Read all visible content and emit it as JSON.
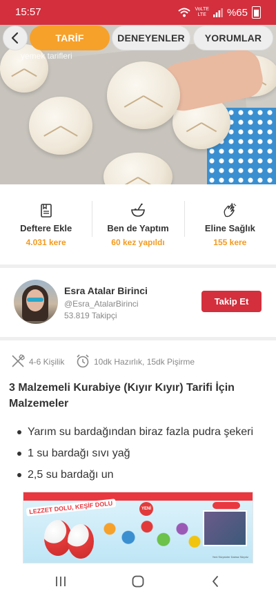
{
  "status_bar": {
    "time": "15:57",
    "network_top": "VoLTE",
    "network_bottom": "LTE",
    "battery": "%65"
  },
  "hero": {
    "watermark": "yemek tarifleri",
    "image_description": "powdered sugar cookies on a baking tray"
  },
  "nav": {
    "back_icon": "chevron-left-icon",
    "tabs": [
      {
        "label": "TARİF",
        "active": true
      },
      {
        "label": "DENEYENLER",
        "active": false
      },
      {
        "label": "YORUMLAR",
        "active": false
      }
    ],
    "active_color": "#f6a12a"
  },
  "actions": [
    {
      "icon": "notebook-icon",
      "label": "Deftere Ekle",
      "count": "4.031 kere"
    },
    {
      "icon": "mixing-bowl-icon",
      "label": "Ben de Yaptım",
      "count": "60 kez yapıldı"
    },
    {
      "icon": "clapping-hands-icon",
      "label": "Eline Sağlık",
      "count": "155 kere"
    }
  ],
  "author": {
    "name": "Esra Atalar Birinci",
    "handle": "@Esra_AtalarBirinci",
    "followers": "53.819 Takipçi",
    "follow_label": "Takip Et"
  },
  "meta": {
    "servings_icon": "utensils-icon",
    "servings": "4-6 Kişilik",
    "time_icon": "alarm-clock-icon",
    "time": "10dk Hazırlık, 15dk Pişirme"
  },
  "recipe": {
    "title": "3 Malzemeli Kurabiye (Kıyır Kıyır) Tarifi İçin Malzemeler",
    "ingredients": [
      "Yarım su bardağından biraz fazla pudra şekeri",
      "1 su bardağı sıvı yağ",
      "2,5 su bardağı un"
    ]
  },
  "ad": {
    "headline": "LEZZET DOLU, KEŞİF DOLU",
    "badge": "YENİ",
    "fine_print": "Yeni Sürprizler Daima Sürpriz"
  },
  "system_nav": {
    "recents_icon": "recents-icon",
    "home_icon": "home-icon",
    "back_icon": "back-arrow-icon"
  },
  "colors": {
    "brand_red": "#d32f3d",
    "accent_orange": "#f39a1f"
  }
}
